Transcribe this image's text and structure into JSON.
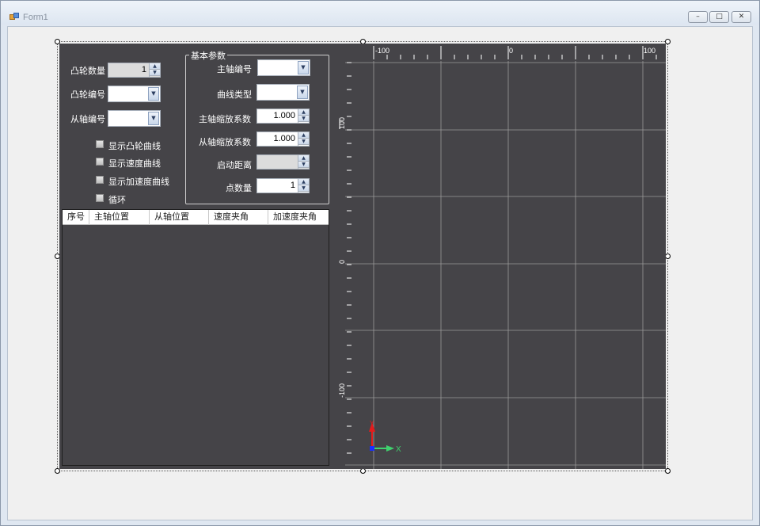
{
  "window": {
    "title": "Form1",
    "buttons": {
      "minimize": "–",
      "maximize": "□",
      "close": "✕"
    }
  },
  "left": {
    "cam_count_label": "凸轮数量",
    "cam_count_value": "1",
    "cam_id_label": "凸轮编号",
    "slave_axis_label": "从轴编号",
    "checkboxes": [
      "显示凸轮曲线",
      "显示速度曲线",
      "显示加速度曲线",
      "循环"
    ]
  },
  "params": {
    "title": "基本参数",
    "master_axis_label": "主轴编号",
    "curve_type_label": "曲线类型",
    "master_scale_label": "主轴缩放系数",
    "master_scale_value": "1.000",
    "slave_scale_label": "从轴缩放系数",
    "slave_scale_value": "1.000",
    "start_distance_label": "启动距离",
    "point_count_label": "点数量",
    "point_count_value": "1"
  },
  "table": {
    "columns": [
      "序号",
      "主轴位置",
      "从轴位置",
      "速度夹角",
      "加速度夹角"
    ]
  },
  "plot": {
    "x_tick_labels": [
      "-100",
      "0",
      "100"
    ],
    "y_tick_labels": [
      "100",
      "0",
      "-100"
    ],
    "axis_x_label": "X",
    "axis_y_label": "Y",
    "colors": {
      "background": "#454448",
      "grid": "#9a9a9a",
      "x_axis": "#3fd06e",
      "y_axis": "#e21c1c",
      "origin": "#1a2fff"
    }
  }
}
